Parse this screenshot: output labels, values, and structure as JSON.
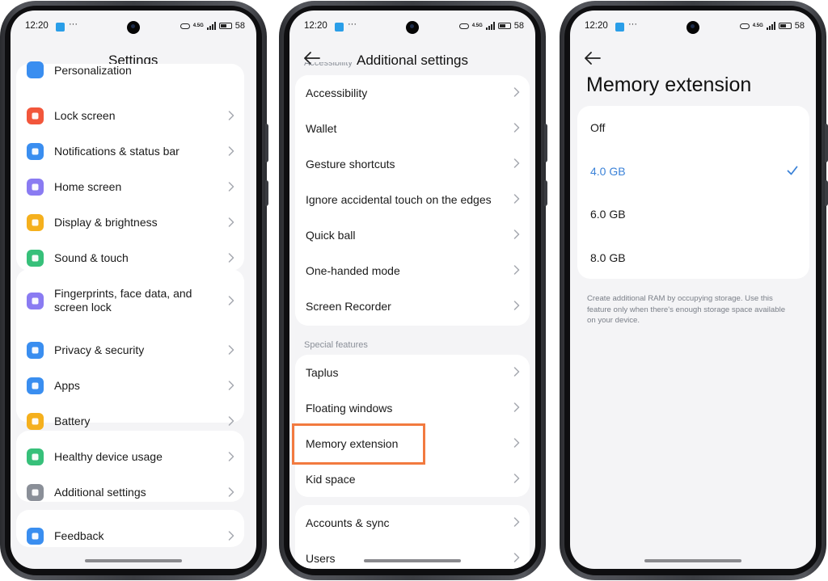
{
  "status": {
    "time": "12:20",
    "dots": "···",
    "network": "4.5G",
    "battery": "58"
  },
  "phone1": {
    "title": "Settings",
    "partial_item": "Personalization",
    "groups": [
      [
        {
          "label": "Lock screen",
          "icon": "lock-icon",
          "color": "#f2563b"
        },
        {
          "label": "Notifications & status bar",
          "icon": "notification-icon",
          "color": "#3a8ef0"
        },
        {
          "label": "Home screen",
          "icon": "home-icon",
          "color": "#8a7bf2"
        },
        {
          "label": "Display & brightness",
          "icon": "sun-icon",
          "color": "#f5b01d"
        },
        {
          "label": "Sound & touch",
          "icon": "speaker-icon",
          "color": "#37c07a"
        }
      ],
      [
        {
          "label": "Fingerprints, face data, and screen lock",
          "icon": "fingerprint-icon",
          "color": "#8a7bf2"
        },
        {
          "label": "Privacy & security",
          "icon": "shield-icon",
          "color": "#3a8ef0"
        },
        {
          "label": "Apps",
          "icon": "gear-icon",
          "color": "#3a8ef0"
        },
        {
          "label": "Battery",
          "icon": "battery-icon",
          "color": "#f5b01d"
        }
      ],
      [
        {
          "label": "Healthy device usage",
          "icon": "phone-check-icon",
          "color": "#37c07a"
        },
        {
          "label": "Additional settings",
          "icon": "more-icon",
          "color": "#8a8f98"
        }
      ],
      [
        {
          "label": "Feedback",
          "icon": "question-icon",
          "color": "#3a8ef0"
        }
      ]
    ]
  },
  "phone2": {
    "title": "Additional settings",
    "partial_header": "Accessibility",
    "group1": [
      "Accessibility",
      "Wallet",
      "Gesture shortcuts",
      "Ignore accidental touch on the edges",
      "Quick ball",
      "One-handed mode",
      "Screen Recorder"
    ],
    "section": "Special features",
    "group2": [
      "Taplus",
      "Floating windows",
      "Memory extension",
      "Kid space"
    ],
    "group3": [
      "Accounts & sync",
      "Users"
    ]
  },
  "phone3": {
    "title": "Memory extension",
    "options": [
      {
        "label": "Off",
        "selected": false
      },
      {
        "label": "4.0 GB",
        "selected": true
      },
      {
        "label": "6.0 GB",
        "selected": false
      },
      {
        "label": "8.0 GB",
        "selected": false
      }
    ],
    "note": "Create additional RAM by occupying storage. Use this feature only when there's enough storage space available on your device."
  },
  "colors": {
    "accent": "#3b82d8",
    "highlight": "#f27a3f",
    "background": "#f4f4f6"
  }
}
